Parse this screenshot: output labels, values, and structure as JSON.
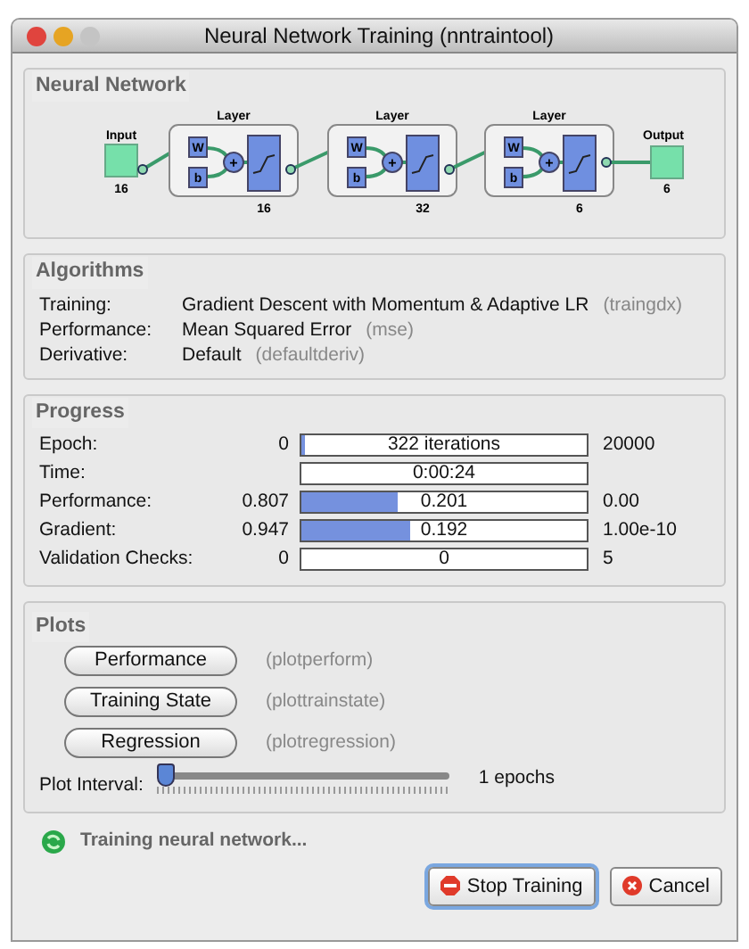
{
  "window": {
    "title": "Neural Network Training (nntraintool)"
  },
  "network": {
    "heading": "Neural Network",
    "input": {
      "label": "Input",
      "size": "16"
    },
    "layers": [
      {
        "title": "Layer",
        "weight": "W",
        "bias": "b",
        "sum": "+",
        "size": "16"
      },
      {
        "title": "Layer",
        "weight": "W",
        "bias": "b",
        "sum": "+",
        "size": "32"
      },
      {
        "title": "Layer",
        "weight": "W",
        "bias": "b",
        "sum": "+",
        "size": "6"
      }
    ],
    "output": {
      "label": "Output",
      "size": "6"
    }
  },
  "algorithms": {
    "heading": "Algorithms",
    "rows": [
      {
        "label": "Training:",
        "value": "Gradient Descent with Momentum & Adaptive LR",
        "code": "(traingdx)"
      },
      {
        "label": "Performance:",
        "value": "Mean Squared Error",
        "code": "(mse)"
      },
      {
        "label": "Derivative:",
        "value": "Default",
        "code": "(defaultderiv)"
      }
    ]
  },
  "progress": {
    "heading": "Progress",
    "rows": [
      {
        "label": "Epoch:",
        "start": "0",
        "reading": "322 iterations",
        "end": "20000",
        "level": 0.01
      },
      {
        "label": "Time:",
        "reading": "0:00:24"
      },
      {
        "label": "Performance:",
        "start": "0.807",
        "reading": "0.201",
        "end": "0.00",
        "level": 0.34
      },
      {
        "label": "Gradient:",
        "start": "0.947",
        "reading": "0.192",
        "end": "1.00e-10",
        "level": 0.38
      },
      {
        "label": "Validation Checks:",
        "start": "0",
        "reading": "0",
        "end": "5"
      }
    ]
  },
  "plots": {
    "heading": "Plots",
    "buttons": [
      {
        "label": "Performance",
        "code": "(plotperform)"
      },
      {
        "label": "Training State",
        "code": "(plottrainstate)"
      },
      {
        "label": "Regression",
        "code": "(plotregression)"
      }
    ],
    "interval": {
      "label": "Plot Interval:",
      "level": 0,
      "reading": "1 epochs"
    }
  },
  "status": "Training neural network...",
  "buttons": [
    {
      "label": "Stop Training",
      "kind": "stop",
      "focused": true
    },
    {
      "label": "Cancel",
      "kind": "cancel",
      "focused": false
    }
  ]
}
